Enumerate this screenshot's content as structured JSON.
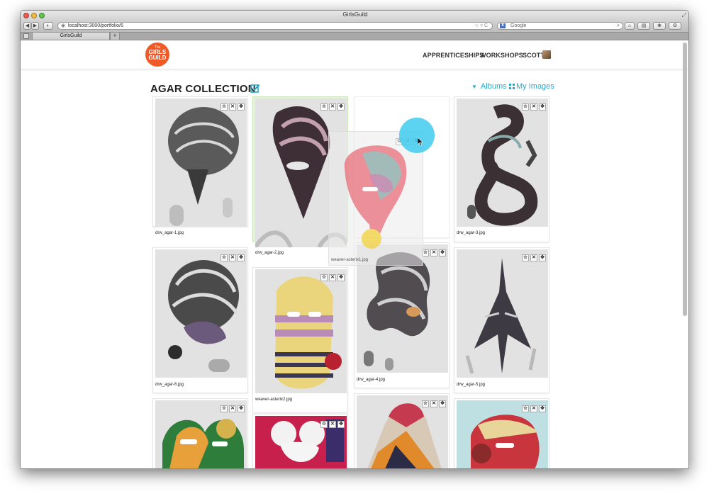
{
  "window": {
    "title": "GirlsGuild"
  },
  "browser": {
    "url": "localhost:3000/portfolio/6",
    "search_placeholder": "Google",
    "search_badge": "8",
    "tab_title": "GirlsGuild",
    "new_tab": "+",
    "back": "◀",
    "forward": "▶",
    "url_icons": "☆ ▿ C"
  },
  "site": {
    "logo": {
      "line1": "The",
      "line2": "GIRLS",
      "line3": "GUILD"
    },
    "nav": {
      "apprenticeships": "APPRENTICESHIPS",
      "workshops": "WORKSHOPS",
      "user": "SCOTT"
    }
  },
  "page": {
    "title": "AGAR COLLECTION",
    "albums_label": "Albums",
    "my_images_label": "My Images",
    "controls": {
      "star": "☆",
      "remove": "✕",
      "move": "✥"
    }
  },
  "images": [
    {
      "filename": "drw_agar-1.jpg",
      "selected": false
    },
    {
      "filename": "drw_agar-2.jpg",
      "selected": true
    },
    {
      "filename": "drw_agar-3.jpg",
      "selected": false
    },
    {
      "filename": "drw_agar-6.jpg",
      "selected": false
    },
    {
      "filename": "weaver-asterix2.jpg",
      "selected": false
    },
    {
      "filename": "drw_agar-4.jpg",
      "selected": false
    },
    {
      "filename": "drw_agar-5.jpg",
      "selected": false
    },
    {
      "filename": "",
      "selected": false
    },
    {
      "filename": "",
      "selected": false
    },
    {
      "filename": "",
      "selected": false
    },
    {
      "filename": "",
      "selected": false
    }
  ],
  "dragging": {
    "filename": "weaver-asterix1.jpg"
  },
  "colors": {
    "accent": "#29a8c6",
    "logo": "#f05a28",
    "selected_card": "#e3f2d8",
    "drag_halo": "#40cdee"
  }
}
